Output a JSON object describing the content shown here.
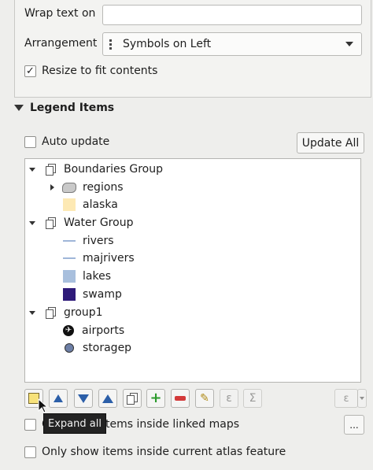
{
  "legend_options": {
    "wrap_text_label": "Wrap text on",
    "wrap_text_value": "",
    "arrangement_label": "Arrangement",
    "arrangement_value": "Symbols on Left",
    "resize_label": "Resize to fit contents",
    "resize_checked": true
  },
  "legend_items": {
    "title": "Legend Items",
    "auto_update_label": "Auto update",
    "auto_update_checked": false,
    "update_all_label": "Update All"
  },
  "tree": [
    {
      "label": "Boundaries Group",
      "type": "group"
    },
    {
      "label": "regions",
      "type": "layer-polygon"
    },
    {
      "label": "alaska",
      "type": "fill",
      "color": "#fde9b4"
    },
    {
      "label": "Water Group",
      "type": "group"
    },
    {
      "label": "rivers",
      "type": "line",
      "color": "#9fb6d8"
    },
    {
      "label": "majrivers",
      "type": "line",
      "color": "#9fb6d8"
    },
    {
      "label": "lakes",
      "type": "fill",
      "color": "#a8bfdd"
    },
    {
      "label": "swamp",
      "type": "fill",
      "color": "#2e1a79"
    },
    {
      "label": "group1",
      "type": "group"
    },
    {
      "label": "airports",
      "type": "airport"
    },
    {
      "label": "storagep",
      "type": "point",
      "color": "#6d7fa6"
    }
  ],
  "toolbar_icons": [
    "expand-all-icon",
    "move-up-icon",
    "move-down-icon",
    "move-up-arrow-icon",
    "add-group-icon",
    "add-item-icon",
    "remove-item-icon",
    "edit-item-icon",
    "expression-icon",
    "sum-icon",
    "expression-filter-icon"
  ],
  "tooltip": "Expand all",
  "linked_maps_label": "Only show items inside linked maps",
  "linked_maps_checked": false,
  "linked_maps_more": "...",
  "atlas_label": "Only show items inside current atlas feature",
  "atlas_checked": false
}
